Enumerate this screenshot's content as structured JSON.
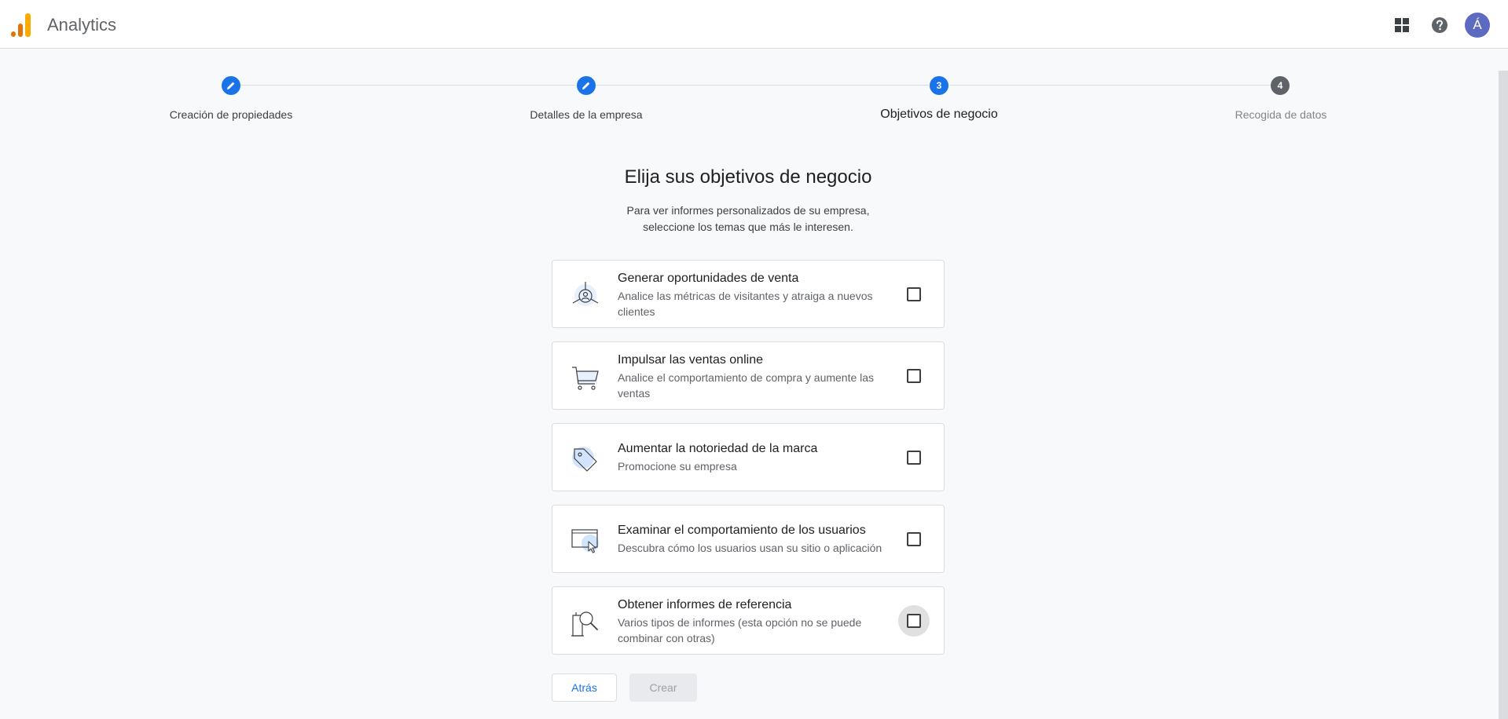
{
  "header": {
    "app_title": "Analytics",
    "icons": [
      "apps-icon",
      "help-icon"
    ],
    "avatar_initial": "Á",
    "colors": {
      "logo_dark": "#e37400",
      "logo_light": "#f9ab00",
      "avatar": "#5c6bc0"
    }
  },
  "stepper": {
    "steps": [
      {
        "label": "Creación de propiedades",
        "state": "completed"
      },
      {
        "label": "Detalles de la empresa",
        "state": "completed"
      },
      {
        "label": "Objetivos de negocio",
        "state": "active",
        "number": "3"
      },
      {
        "label": "Recogida de datos",
        "state": "future",
        "number": "4"
      }
    ],
    "colors": {
      "completed": "#1a73e8",
      "active": "#1a73e8",
      "future": "#5f6368"
    }
  },
  "main": {
    "title": "Elija sus objetivos de negocio",
    "subtitle_line1": "Para ver informes personalizados de su empresa,",
    "subtitle_line2": "seleccione los temas que más le interesen.",
    "options": [
      {
        "title": "Generar oportunidades de venta",
        "description": "Analice las métricas de visitantes y atraiga a nuevos clientes",
        "icon": "leads-icon",
        "checked": false
      },
      {
        "title": "Impulsar las ventas online",
        "description": "Analice el comportamiento de compra y aumente las ventas",
        "icon": "cart-icon",
        "checked": false
      },
      {
        "title": "Aumentar la notoriedad de la marca",
        "description": "Promocione su empresa",
        "icon": "tag-icon",
        "checked": false
      },
      {
        "title": "Examinar el comportamiento de los usuarios",
        "description": "Descubra cómo los usuarios usan su sitio o aplicación",
        "icon": "screen-cursor-icon",
        "checked": false
      },
      {
        "title": "Obtener informes de referencia",
        "description": "Varios tipos de informes (esta opción no se puede combinar con otras)",
        "icon": "magnifier-document-icon",
        "checked": false
      }
    ]
  },
  "actions": {
    "back_label": "Atrás",
    "create_label": "Crear"
  }
}
